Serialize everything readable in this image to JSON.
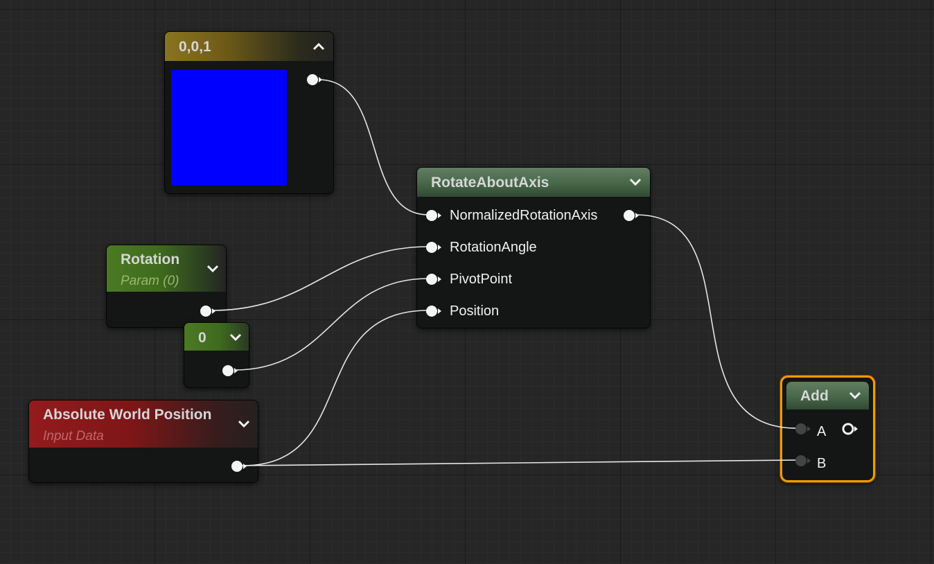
{
  "colors": {
    "swatch": "#0000ff",
    "constant3_header": "#8a7420",
    "function_header": "#4a6a4c",
    "scalar_header": "#4b7a23",
    "input_header": "#931b1c",
    "selection_outline": "#f09a00",
    "wire": "#e6e6e6"
  },
  "nodes": {
    "constant3": {
      "title": "0,0,1",
      "collapse_icon": "chevron-up-icon"
    },
    "rotate": {
      "title": "RotateAboutAxis",
      "inputs": [
        "NormalizedRotationAxis",
        "RotationAngle",
        "PivotPoint",
        "Position"
      ]
    },
    "rotation": {
      "title": "Rotation",
      "subtitle": "Param (0)"
    },
    "zero": {
      "title": "0"
    },
    "awp": {
      "title": "Absolute World Position",
      "subtitle": "Input Data"
    },
    "add": {
      "title": "Add",
      "inputs": [
        "A",
        "B"
      ],
      "selected": true
    }
  }
}
